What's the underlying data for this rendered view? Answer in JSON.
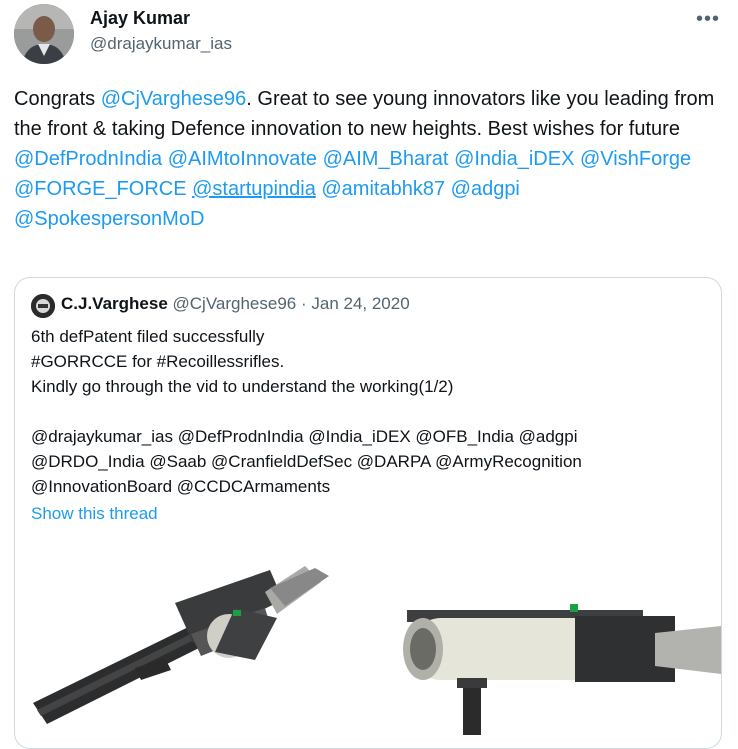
{
  "author": {
    "name": "Ajay Kumar",
    "handle": "@drajaykumar_ias"
  },
  "more_icon": "more-horizontal-icon",
  "tweet": {
    "t1": "Congrats ",
    "m1": "@CjVarghese96",
    "t2": ". Great to see young innovators like you leading from the front & taking Defence innovation to new heights. Best wishes for future",
    "mentions_line1": [
      "@DefProdnIndia",
      "@AIMtoInnovate",
      "@AIM_Bharat",
      "@India_iDEX",
      "@VishForge"
    ],
    "mentions_line2": [
      "@FORGE_FORCE",
      "@startupindia",
      "@amitabhk87",
      "@adgpi"
    ],
    "mentions_line3": [
      "@SpokespersonMoD"
    ]
  },
  "quote": {
    "name": "C.J.Varghese",
    "handle": "@CjVarghese96",
    "sep": " · ",
    "date": "Jan 24, 2020",
    "lines": [
      "6th defPatent filed successfully",
      "#GORRCCE for #Recoillessrifles.",
      "Kindly go through the vid to understand the working(1/2)",
      "",
      "@drajaykumar_ias @DefProdnIndia @India_iDEX @OFB_India @adgpi",
      "@DRDO_India @Saab @CranfieldDefSec @DARPA @ArmyRecognition",
      "@InnovationBoard @CCDCArmaments"
    ],
    "show_thread": "Show this thread"
  },
  "colors": {
    "link": "#1d9bf0",
    "text": "#0f1419",
    "secondary": "#536471",
    "border": "#cfd9de"
  }
}
